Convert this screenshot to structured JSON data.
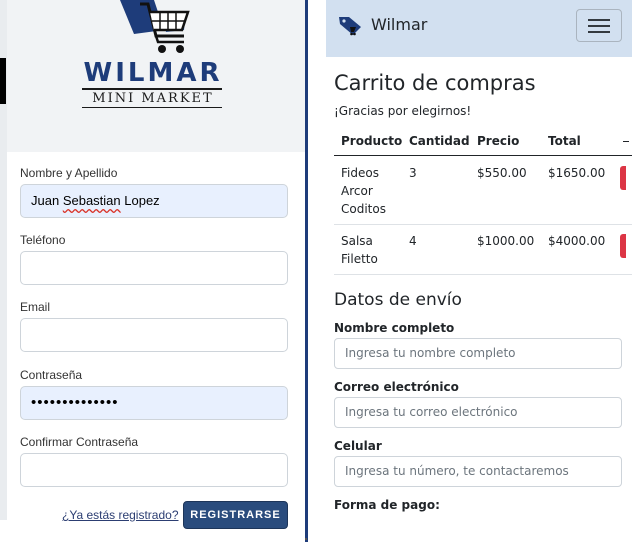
{
  "register": {
    "logo": {
      "title": "WILMAR",
      "subtitle": "MINI MARKET"
    },
    "fields": [
      {
        "label": "Nombre y Apellido",
        "value": "Juan Sebastian Lopez",
        "filled": true
      },
      {
        "label": "Teléfono",
        "value": "",
        "filled": false
      },
      {
        "label": "Email",
        "value": "",
        "filled": false
      },
      {
        "label": "Contraseña",
        "value": "••••••••••••••",
        "filled": true
      },
      {
        "label": "Confirmar Contraseña",
        "value": "",
        "filled": false
      }
    ],
    "name_parts": {
      "first": "Juan ",
      "middle": "Sebastian",
      "last": " Lopez"
    },
    "already_registered_link": "¿Ya estás registrado?",
    "register_button": "REGISTRARSE",
    "colors": {
      "brand_blue": "#1e3c7a",
      "button": "#2a4c7d",
      "autofill": "#e8f0fe"
    }
  },
  "cart": {
    "navbar": {
      "brand": "Wilmar",
      "brand_icon": "shopping-tag-icon",
      "menu_icon": "hamburger-icon"
    },
    "title": "Carrito de compras",
    "thanks": "¡Gracias por elegirnos!",
    "table": {
      "headers": [
        "Producto",
        "Cantidad",
        "Precio",
        "Total"
      ],
      "rows": [
        {
          "product_lines": [
            "Fideos",
            "Arcor",
            "Coditos"
          ],
          "quantity": "3",
          "price": "$550.00",
          "total": "$1650.00"
        },
        {
          "product_lines": [
            "Salsa",
            "Filetto"
          ],
          "quantity": "4",
          "price": "$1000.00",
          "total": "$4000.00"
        }
      ]
    },
    "shipping": {
      "title": "Datos de envío",
      "fields": [
        {
          "label": "Nombre completo",
          "placeholder": "Ingresa tu nombre completo"
        },
        {
          "label": "Correo electrónico",
          "placeholder": "Ingresa tu correo electrónico"
        },
        {
          "label": "Celular",
          "placeholder": "Ingresa tu número, te contactaremos"
        }
      ],
      "payment_label": "Forma de pago:"
    },
    "colors": {
      "navbar": "#d2e0f0",
      "delete_button": "#dc3545"
    }
  }
}
